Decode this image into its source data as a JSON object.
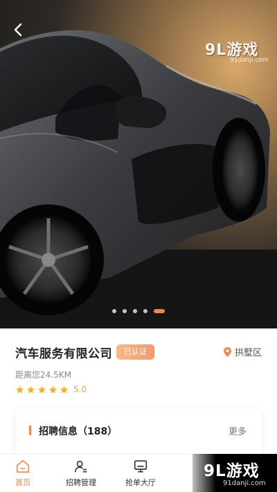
{
  "hero": {
    "carousel_total": 5,
    "carousel_active_index": 4,
    "watermark": {
      "brand": "9L游戏",
      "url": "91danji.com"
    }
  },
  "company": {
    "name": "汽车服务有限公司",
    "verified_label": "已认证",
    "location": "拱墅区",
    "distance": "距离您24.5KM",
    "rating": "5.0",
    "stars": 5
  },
  "recruitment": {
    "title": "招聘信息（188）",
    "more_label": "更多"
  },
  "tabbar": {
    "items": [
      {
        "label": "首页",
        "icon": "home-icon",
        "active": true
      },
      {
        "label": "招聘管理",
        "icon": "recruit-icon",
        "active": false
      },
      {
        "label": "抢单大厅",
        "icon": "order-hall-icon",
        "active": false
      }
    ]
  },
  "bottom_watermark": {
    "brand": "9L游戏",
    "url": "91danji.com"
  },
  "colors": {
    "accent": "#f0874e",
    "star": "#f2b431",
    "badge": "#f39b68"
  }
}
